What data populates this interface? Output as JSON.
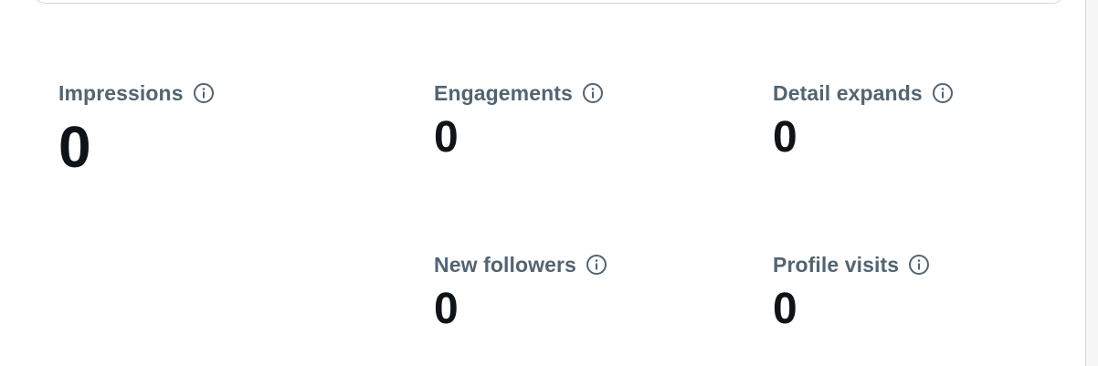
{
  "metrics": {
    "impressions": {
      "label": "Impressions",
      "value": "0",
      "icon": "info-icon"
    },
    "engagements": {
      "label": "Engagements",
      "value": "0",
      "icon": "info-icon"
    },
    "detail_expands": {
      "label": "Detail expands",
      "value": "0",
      "icon": "info-icon"
    },
    "new_followers": {
      "label": "New followers",
      "value": "0",
      "icon": "info-icon"
    },
    "profile_visits": {
      "label": "Profile visits",
      "value": "0",
      "icon": "info-icon"
    }
  },
  "colors": {
    "label": "#536471",
    "value": "#0f1419",
    "border": "#cfd9de"
  }
}
